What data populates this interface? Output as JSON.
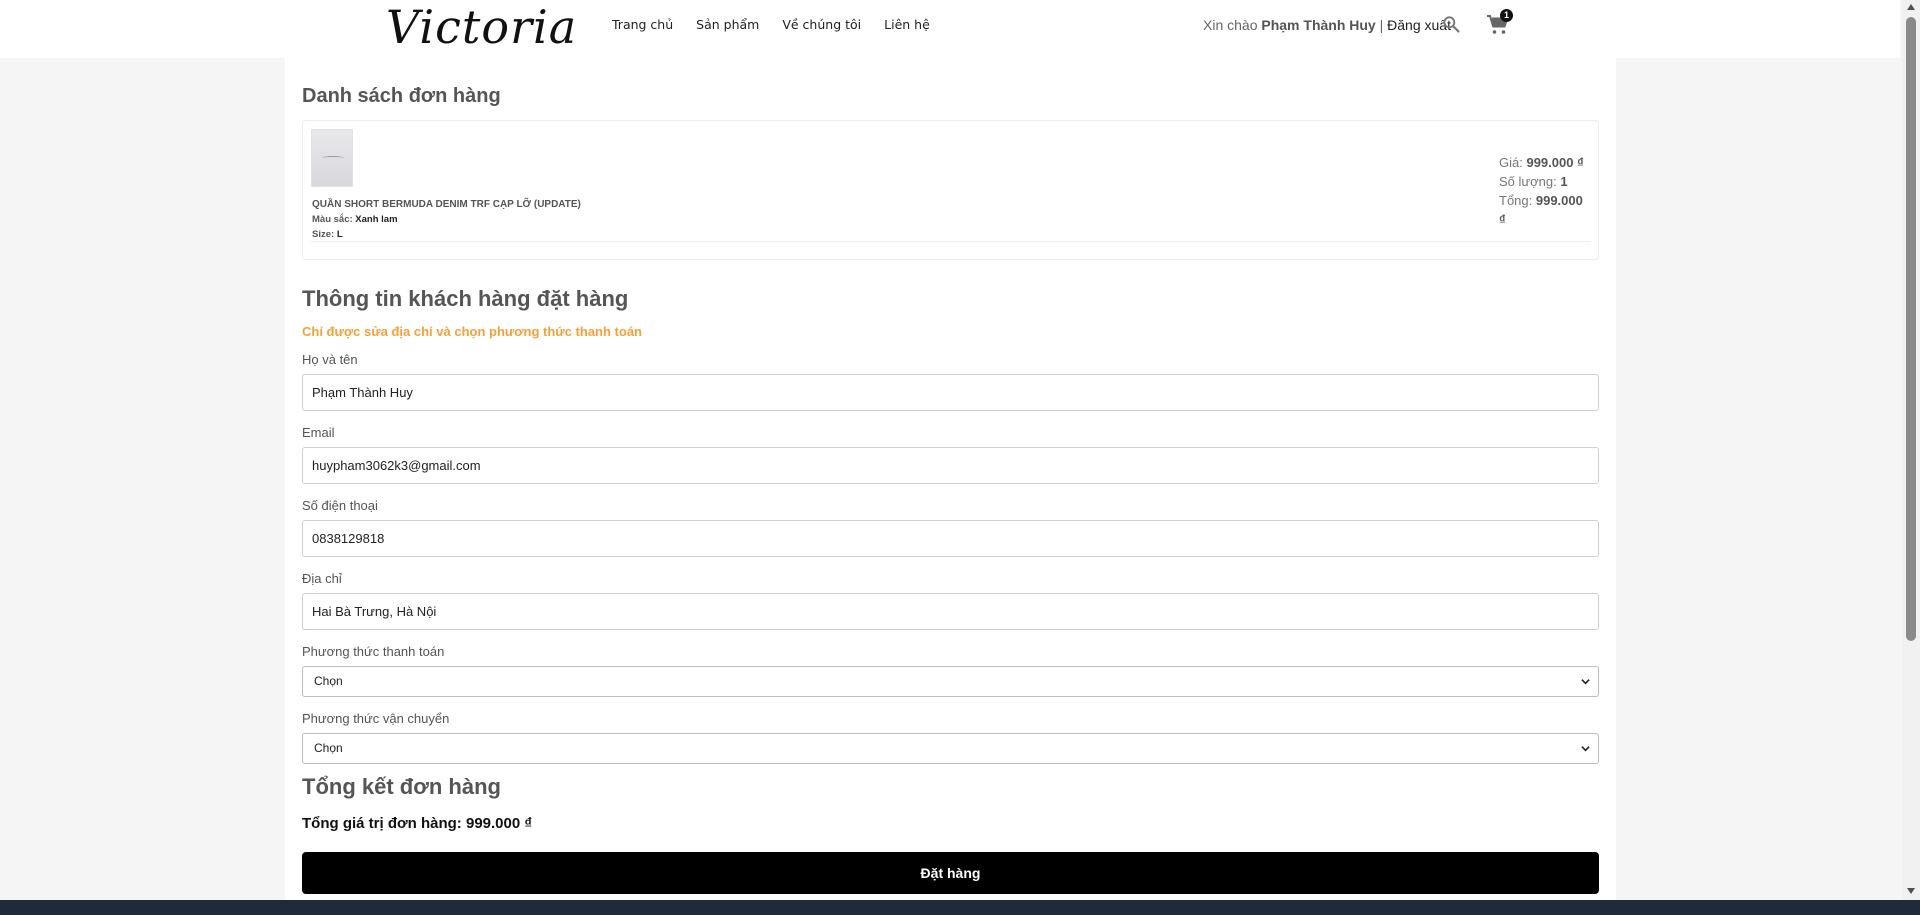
{
  "header": {
    "logo": "Victoria",
    "nav": [
      "Trang chủ",
      "Sản phẩm",
      "Về chúng tôi",
      "Liên hệ"
    ],
    "greeting_prefix": "Xin chào ",
    "username": "Phạm Thành Huy",
    "separator": " | ",
    "logout": "Đăng xuất",
    "cart_count": "1"
  },
  "orders": {
    "title": "Danh sách đơn hàng",
    "item": {
      "name": "QUẦN SHORT BERMUDA DENIM TRF CẠP LỠ (UPDATE)",
      "color_label": "Màu sắc: ",
      "color": "Xanh lam",
      "size_label": "Size: ",
      "size": "L",
      "price_label": "Giá: ",
      "price": "999.000 ₫",
      "qty_label": "Số lượng: ",
      "qty": "1",
      "total_label": "Tổng: ",
      "total": "999.000 ₫"
    }
  },
  "customer": {
    "title": "Thông tin khách hàng đặt hàng",
    "note": "Chỉ được sửa địa chỉ và chọn phương thức thanh toán",
    "name_label": "Họ và tên",
    "name_value": "Phạm Thành Huy",
    "email_label": "Email",
    "email_value": "huypham3062k3@gmail.com",
    "phone_label": "Số điện thoại",
    "phone_value": "0838129818",
    "address_label": "Địa chỉ",
    "address_value": "Hai Bà Trưng, Hà Nội",
    "payment_label": "Phương thức thanh toán",
    "payment_value": "Chọn",
    "shipping_label": "Phương thức vận chuyển",
    "shipping_value": "Chọn"
  },
  "summary": {
    "title": "Tổng kết đơn hàng",
    "total_text": "Tổng giá trị đơn hàng: 999.000 ₫",
    "order_button": "Đặt hàng"
  }
}
